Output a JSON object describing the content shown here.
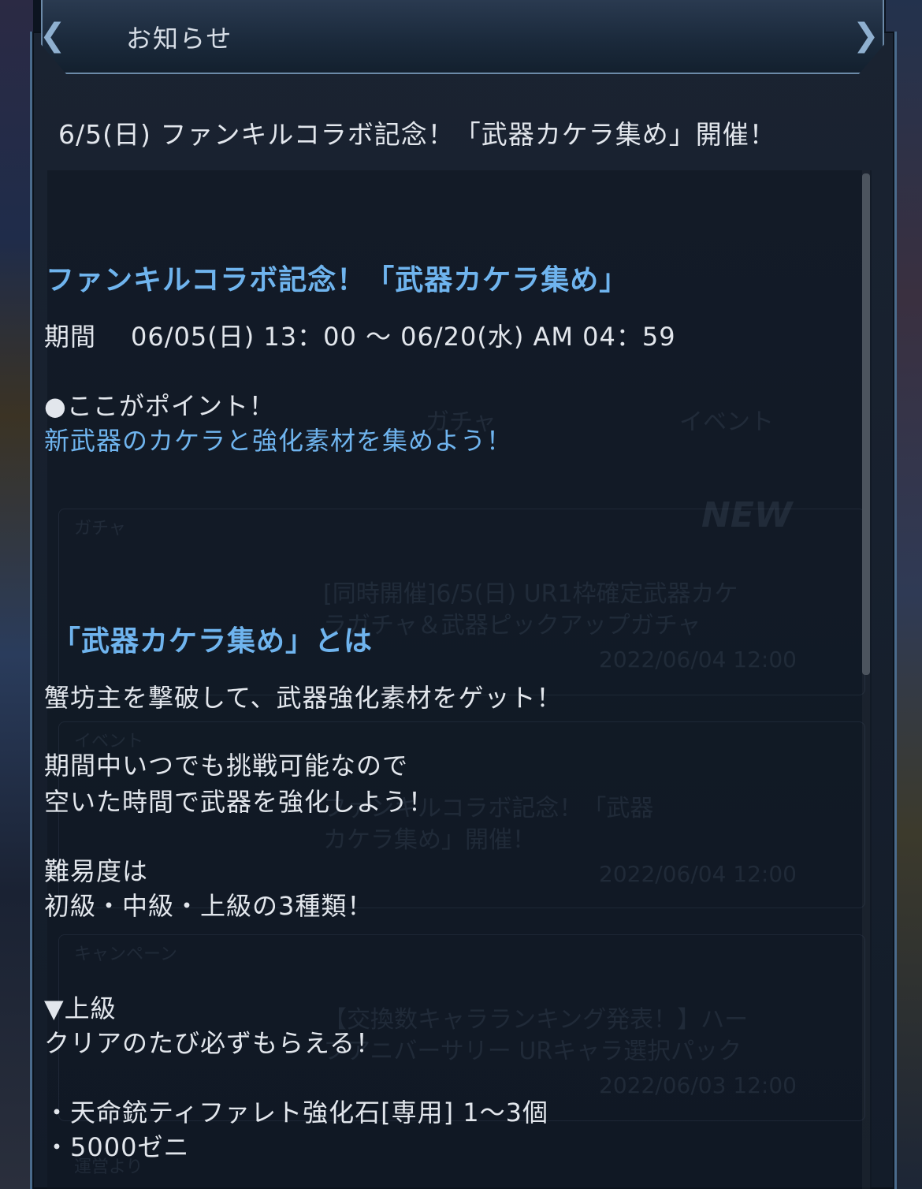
{
  "header": {
    "title": "お知らせ"
  },
  "notice": {
    "title": "6/5(日) ファンキルコラボ記念！「武器カケラ集め」開催！"
  },
  "body": {
    "heading1": "ファンキルコラボ記念！「武器カケラ集め」",
    "period_label": "期間",
    "period_value": "06/05(日) 13：00 ～ 06/20(水) AM 04：59",
    "point_label": "●ここがポイント！",
    "point_text": "新武器のカケラと強化素材を集めよう！",
    "heading2": "「武器カケラ集め」とは",
    "line1": "蟹坊主を撃破して、武器強化素材をゲット！",
    "line2": "期間中いつでも挑戦可能なので",
    "line3": "空いた時間で武器を強化しよう！",
    "line4": "難易度は",
    "line5": "初級・中級・上級の3種類！",
    "line6": "▼上級",
    "line7": "クリアのたび必ずもらえる！",
    "line8": "・天命銃ティファレト強化石[専用] 1～3個",
    "line9": "・5000ゼニ"
  },
  "background": {
    "tab1": "ガチャ",
    "tab2": "イベント",
    "new_badge": "NEW",
    "section1": "ガチャ",
    "item1_line1": "[同時開催]6/5(日) UR1枠確定武器カケ",
    "item1_line2": "ラガチャ＆武器ピックアップガチャ",
    "item1_date": "2022/06/04 12:00",
    "section2": "イベント",
    "item2_line1": "ファンキルコラボ記念！「武器",
    "item2_line2": "カケラ集め」開催！",
    "item2_date": "2022/06/04 12:00",
    "section3": "キャンペーン",
    "item3_line1": "【交換数キャラランキング発表！】ハー",
    "item3_line2": "フアニバーサリー URキャラ選択パック",
    "item3_date": "2022/06/03 12:00",
    "section4": "運営より"
  },
  "colors": {
    "accent_blue": "#6fb4ee",
    "text": "#e2e6ec",
    "panel": "#131c29",
    "border": "#4a6b8c"
  }
}
